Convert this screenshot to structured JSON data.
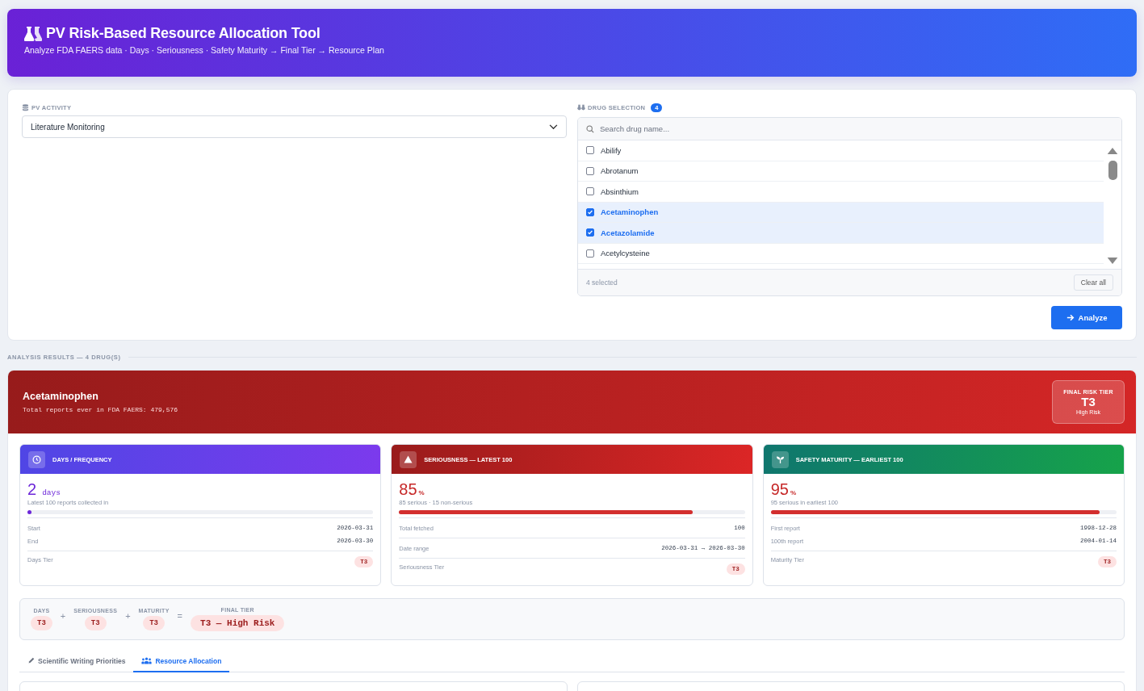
{
  "header": {
    "title": "PV Risk-Based Resource Allocation Tool",
    "subtitle": "Analyze FDA FAERS data · Days · Seriousness · Safety Maturity → Final Tier → Resource Plan"
  },
  "config": {
    "activity": {
      "label": "PV ACTIVITY",
      "value": "Literature Monitoring"
    },
    "drug_selection": {
      "label": "DRUG SELECTION",
      "count": "4",
      "search_placeholder": "Search drug name...",
      "items": [
        {
          "name": "Abilify",
          "checked": false
        },
        {
          "name": "Abrotanum",
          "checked": false
        },
        {
          "name": "Absinthium",
          "checked": false
        },
        {
          "name": "Acetaminophen",
          "checked": true
        },
        {
          "name": "Acetazolamide",
          "checked": true
        },
        {
          "name": "Acetylcysteine",
          "checked": false
        }
      ],
      "selected_text": "4 selected",
      "clear_button": "Clear all"
    },
    "analyze_button": "Analyze"
  },
  "results_heading": "ANALYSIS RESULTS — 4 DRUG(S)",
  "drug": {
    "name": "Acetaminophen",
    "total_reports": "Total reports ever in FDA FAERS: 479,576",
    "final_tier": {
      "label": "FINAL RISK TIER",
      "tier": "T3",
      "risk": "High Risk"
    },
    "metrics": [
      {
        "kind": "days",
        "title": "DAYS / FREQUENCY",
        "value": "2",
        "unit": "days",
        "caption": "Latest 100 reports collected in",
        "level": 0.01,
        "groups": [
          [
            {
              "label": "Start",
              "value": "2026-03-31"
            },
            {
              "label": "End",
              "value": "2026-03-30"
            }
          ]
        ],
        "tier_label": "Days Tier",
        "tier": "T3"
      },
      {
        "kind": "seriousness",
        "title": "SERIOUSNESS — LATEST 100",
        "value": "85",
        "unit": "%",
        "caption": "85 serious · 15 non-serious",
        "level": 0.85,
        "groups": [
          [
            {
              "label": "Total fetched",
              "value": "100"
            }
          ],
          [
            {
              "label": "Date range",
              "value": "2026-03-31 → 2026-03-30"
            }
          ]
        ],
        "tier_label": "Seriousness Tier",
        "tier": "T3"
      },
      {
        "kind": "maturity",
        "title": "SAFETY MATURITY — EARLIEST 100",
        "value": "95",
        "unit": "%",
        "caption": "95 serious in earliest 100",
        "level": 0.95,
        "groups": [
          [
            {
              "label": "First report",
              "value": "1998-12-28"
            },
            {
              "label": "100th report",
              "value": "2004-01-14"
            }
          ]
        ],
        "tier_label": "Maturity Tier",
        "tier": "T3"
      }
    ],
    "tier_summary": [
      {
        "label": "DAYS",
        "tier": "T3"
      },
      {
        "operator": "+",
        "label": "SERIOUSNESS",
        "tier": "T3"
      },
      {
        "operator": "+",
        "label": "MATURITY",
        "tier": "T3"
      }
    ],
    "final_summary": {
      "operator": "=",
      "label": "FINAL TIER",
      "value": "T3 — High Risk"
    },
    "tabs": [
      {
        "label": "Scientific Writing Priorities",
        "selected": false,
        "kind": "writing"
      },
      {
        "label": "Resource Allocation",
        "selected": true,
        "kind": "people"
      }
    ]
  }
}
